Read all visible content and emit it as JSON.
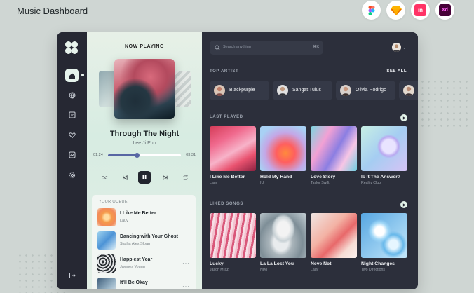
{
  "page_title": "Music Dashboard",
  "tools": [
    {
      "name": "figma-icon"
    },
    {
      "name": "sketch-icon"
    },
    {
      "name": "invision-icon",
      "label": "in"
    },
    {
      "name": "xd-icon",
      "label": "Xd"
    }
  ],
  "player": {
    "label": "NOW PLAYING",
    "title": "Through The Night",
    "artist": "Lee Ji Eun",
    "time_current": "01:24",
    "time_total": "03:31",
    "progress": 0.4
  },
  "queue": {
    "label": "YOUR QUEUE",
    "items": [
      {
        "title": "I Like Me Better",
        "artist": "Lauv",
        "more": "···"
      },
      {
        "title": "Dancing with Your Ghost",
        "artist": "Sasha Alex Sloan",
        "more": "···"
      },
      {
        "title": "Happiest Year",
        "artist": "Jaymes Young",
        "more": "···"
      },
      {
        "title": "It'll Be Okay",
        "artist": "",
        "more": "···"
      }
    ]
  },
  "search": {
    "placeholder": "Search anything",
    "shortcut": "⌘K"
  },
  "top_artist": {
    "label": "TOP ARTIST",
    "see_all": "SEE ALL",
    "artists": [
      {
        "name": "Blackpurple"
      },
      {
        "name": "Sangat Tulus"
      },
      {
        "name": "Olivia Rodrigo"
      },
      {
        "name": ""
      }
    ]
  },
  "last_played": {
    "label": "LAST PLAYED",
    "items": [
      {
        "title": "I Like Me Better",
        "artist": "Lauv"
      },
      {
        "title": "Hold My Hand",
        "artist": "IU"
      },
      {
        "title": "Love Story",
        "artist": "Taylor Swift"
      },
      {
        "title": "Is It The Answer?",
        "artist": "Reality Club"
      }
    ]
  },
  "liked_songs": {
    "label": "LIKED SONGS",
    "items": [
      {
        "title": "Lucky",
        "artist": "Jason Mraz"
      },
      {
        "title": "La La Lost You",
        "artist": "NIKI"
      },
      {
        "title": "Neve Not",
        "artist": "Lauv"
      },
      {
        "title": "Night Changes",
        "artist": "Two Directions"
      }
    ]
  }
}
